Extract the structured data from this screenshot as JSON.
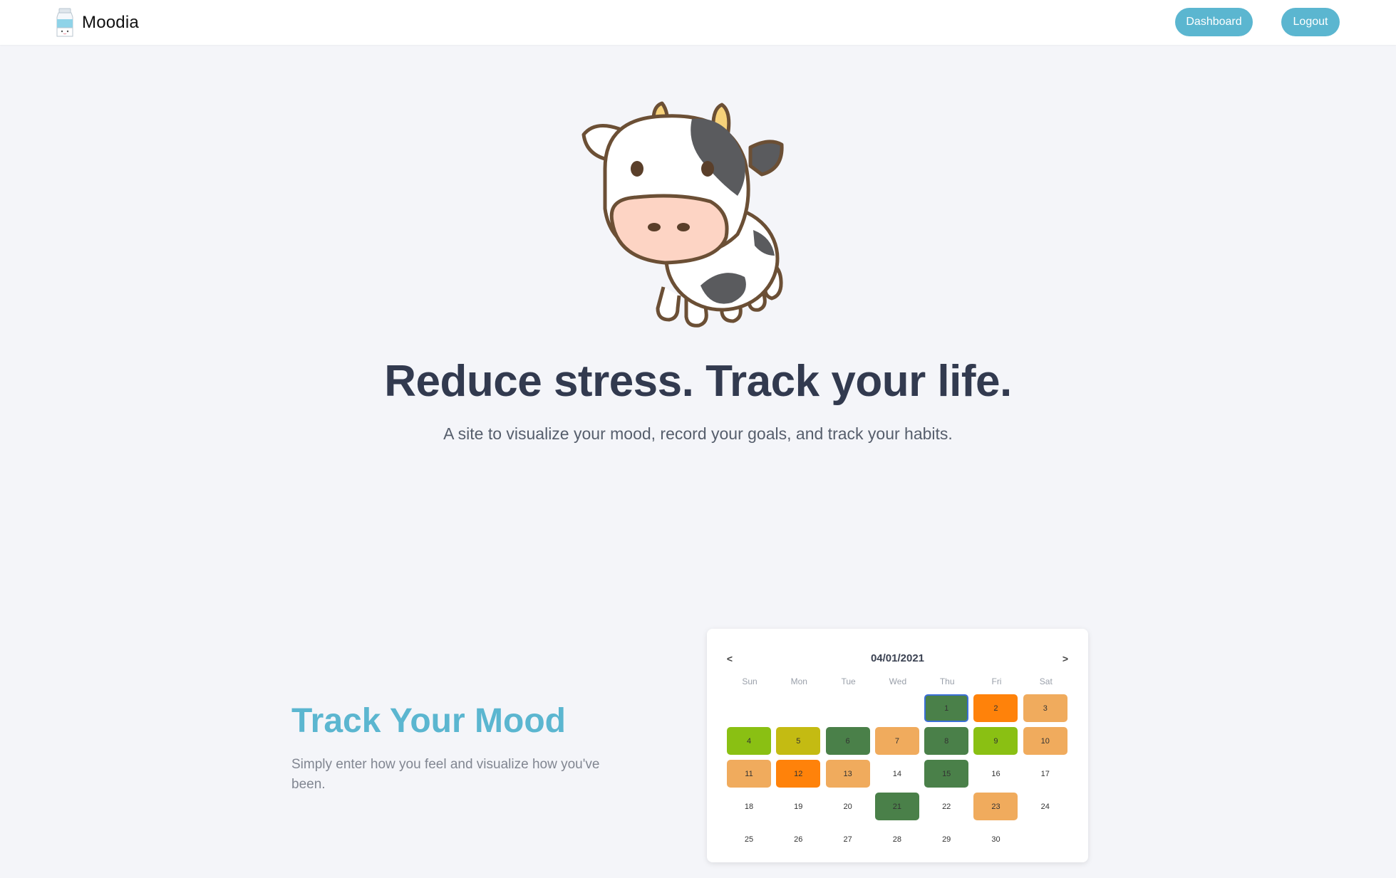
{
  "nav": {
    "brand": "Moodia",
    "dashboard_label": "Dashboard",
    "logout_label": "Logout",
    "accent": "#5bb6d0"
  },
  "hero": {
    "mascot": "cow-illustration",
    "title": "Reduce stress. Track your life.",
    "subtitle": "A site to visualize your mood, record your goals, and track your habits."
  },
  "feature": {
    "title": "Track Your Mood",
    "description": "Simply enter how you feel and visualize how you've been."
  },
  "calendar": {
    "month_label": "04/01/2021",
    "prev_label": "<",
    "next_label": ">",
    "weekdays": [
      "Sun",
      "Mon",
      "Tue",
      "Wed",
      "Thu",
      "Fri",
      "Sat"
    ],
    "leading_blanks": 4,
    "mood_colors": {
      "great": "#4a8049",
      "good": "#8ac013",
      "okay": "#c4bb12",
      "meh": "#f0ab5d",
      "bad": "#ff820a"
    },
    "days": [
      {
        "day": "1",
        "mood": "great",
        "today": true
      },
      {
        "day": "2",
        "mood": "bad"
      },
      {
        "day": "3",
        "mood": "meh"
      },
      {
        "day": "4",
        "mood": "good"
      },
      {
        "day": "5",
        "mood": "okay"
      },
      {
        "day": "6",
        "mood": "great"
      },
      {
        "day": "7",
        "mood": "meh"
      },
      {
        "day": "8",
        "mood": "great"
      },
      {
        "day": "9",
        "mood": "good"
      },
      {
        "day": "10",
        "mood": "meh"
      },
      {
        "day": "11",
        "mood": "meh"
      },
      {
        "day": "12",
        "mood": "bad"
      },
      {
        "day": "13",
        "mood": "meh"
      },
      {
        "day": "14",
        "mood": null
      },
      {
        "day": "15",
        "mood": "great"
      },
      {
        "day": "16",
        "mood": null
      },
      {
        "day": "17",
        "mood": null
      },
      {
        "day": "18",
        "mood": null
      },
      {
        "day": "19",
        "mood": null
      },
      {
        "day": "20",
        "mood": null
      },
      {
        "day": "21",
        "mood": "great"
      },
      {
        "day": "22",
        "mood": null
      },
      {
        "day": "23",
        "mood": "meh"
      },
      {
        "day": "24",
        "mood": null
      },
      {
        "day": "25",
        "mood": null
      },
      {
        "day": "26",
        "mood": null
      },
      {
        "day": "27",
        "mood": null
      },
      {
        "day": "28",
        "mood": null
      },
      {
        "day": "29",
        "mood": null
      },
      {
        "day": "30",
        "mood": null
      }
    ]
  }
}
